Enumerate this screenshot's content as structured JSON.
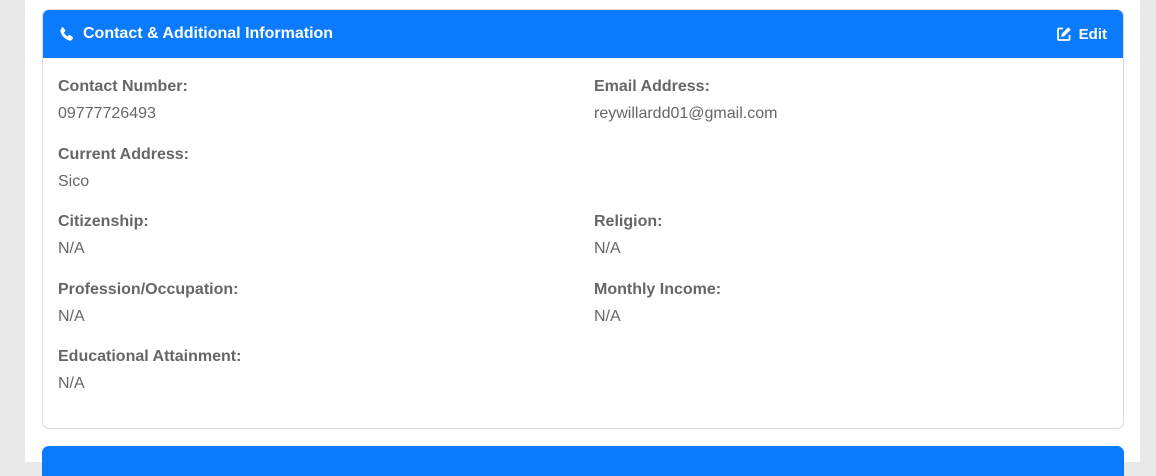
{
  "card": {
    "title": "Contact & Additional Information",
    "edit_label": "Edit",
    "header_color": "#0a7bff",
    "header_icon": "phone-icon",
    "edit_icon": "edit-icon"
  },
  "fields": {
    "contact_number": {
      "label": "Contact Number:",
      "value": "09777726493"
    },
    "email_address": {
      "label": "Email Address:",
      "value": "reywillardd01@gmail.com"
    },
    "current_address": {
      "label": "Current Address:",
      "value": "Sico"
    },
    "citizenship": {
      "label": "Citizenship:",
      "value": "N/A"
    },
    "religion": {
      "label": "Religion:",
      "value": "N/A"
    },
    "profession": {
      "label": "Profession/Occupation:",
      "value": "N/A"
    },
    "monthly_income": {
      "label": "Monthly Income:",
      "value": "N/A"
    },
    "education": {
      "label": "Educational Attainment:",
      "value": "N/A"
    }
  }
}
